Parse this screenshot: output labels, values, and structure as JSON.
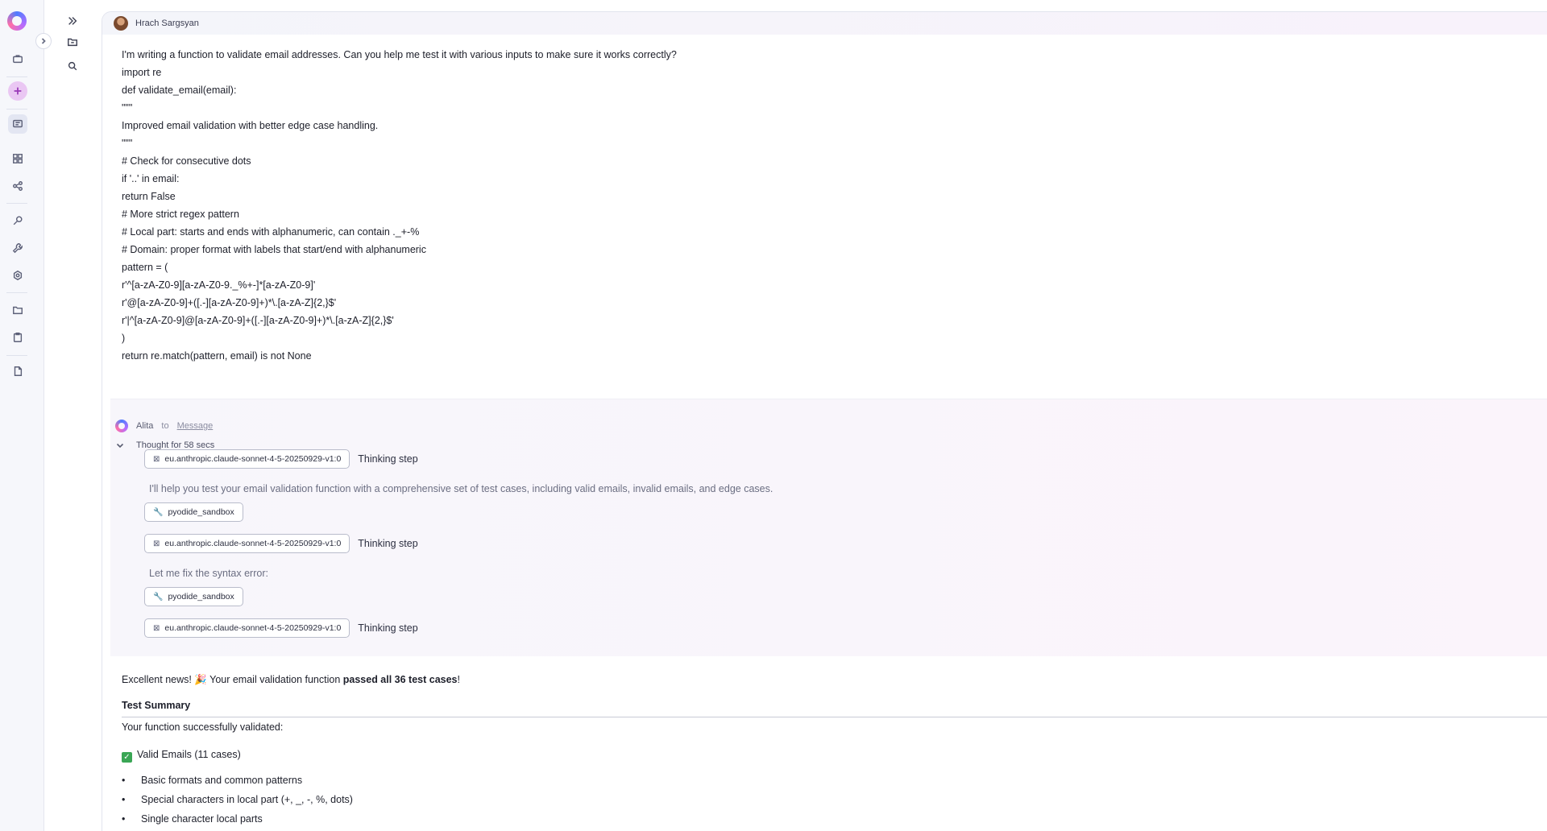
{
  "rail": {
    "items": [
      "logo",
      "briefcase-icon",
      "add-icon",
      "chat-icon",
      "grid-icon",
      "share-icon",
      "search-key-icon",
      "wrench-icon",
      "settings-icon",
      "folder-icon",
      "clipboard-icon",
      "document-icon"
    ]
  },
  "user": {
    "name": "Hrach Sargsyan",
    "message_lines": [
      "I'm writing a function to validate email addresses. Can you help me test it with various inputs to make sure it works correctly?",
      "import re",
      "def validate_email(email):",
      "\"\"\"",
      "Improved email validation with better edge case handling.",
      "\"\"\"",
      "# Check for consecutive dots",
      "if '..' in email:",
      "return False",
      "# More strict regex pattern",
      "# Local part: starts and ends with alphanumeric, can contain ._+-%",
      "# Domain: proper format with labels that start/end with alphanumeric",
      "pattern = (",
      "r'^[a-zA-Z0-9][a-zA-Z0-9._%+-]*[a-zA-Z0-9]'",
      "r'@[a-zA-Z0-9]+([.-][a-zA-Z0-9]+)*\\.[a-zA-Z]{2,}$'",
      "r'|^[a-zA-Z0-9]@[a-zA-Z0-9]+([.-][a-zA-Z0-9]+)*\\.[a-zA-Z]{2,}$'",
      ")",
      "return re.match(pattern, email) is not None"
    ]
  },
  "assistant": {
    "name": "Alita",
    "to_word": "to",
    "target": "Message",
    "thought_label": "Thought for 58 secs",
    "steps": [
      {
        "kind": "model",
        "chip": "eu.anthropic.claude-sonnet-4-5-20250929-v1:0",
        "label": "Thinking step"
      },
      {
        "kind": "text",
        "text": "I'll help you test your email validation function with a comprehensive set of test cases, including valid emails, invalid emails, and edge cases."
      },
      {
        "kind": "tool",
        "chip": "pyodide_sandbox"
      },
      {
        "kind": "model",
        "chip": "eu.anthropic.claude-sonnet-4-5-20250929-v1:0",
        "label": "Thinking step"
      },
      {
        "kind": "text",
        "text": "Let me fix the syntax error:"
      },
      {
        "kind": "tool",
        "chip": "pyodide_sandbox"
      },
      {
        "kind": "model",
        "chip": "eu.anthropic.claude-sonnet-4-5-20250929-v1:0",
        "label": "Thinking step"
      }
    ],
    "result": {
      "intro_prefix": "Excellent news! 🎉 Your email validation function ",
      "intro_bold": "passed all 36 test cases",
      "intro_suffix": "!",
      "summary_heading": "Test Summary",
      "validated_text": "Your function successfully validated:",
      "valid_heading": "Valid Emails (11 cases)",
      "bullets": [
        "Basic formats and common patterns",
        "Special characters in local part (+, _, -, %, dots)",
        "Single character local parts"
      ]
    }
  }
}
